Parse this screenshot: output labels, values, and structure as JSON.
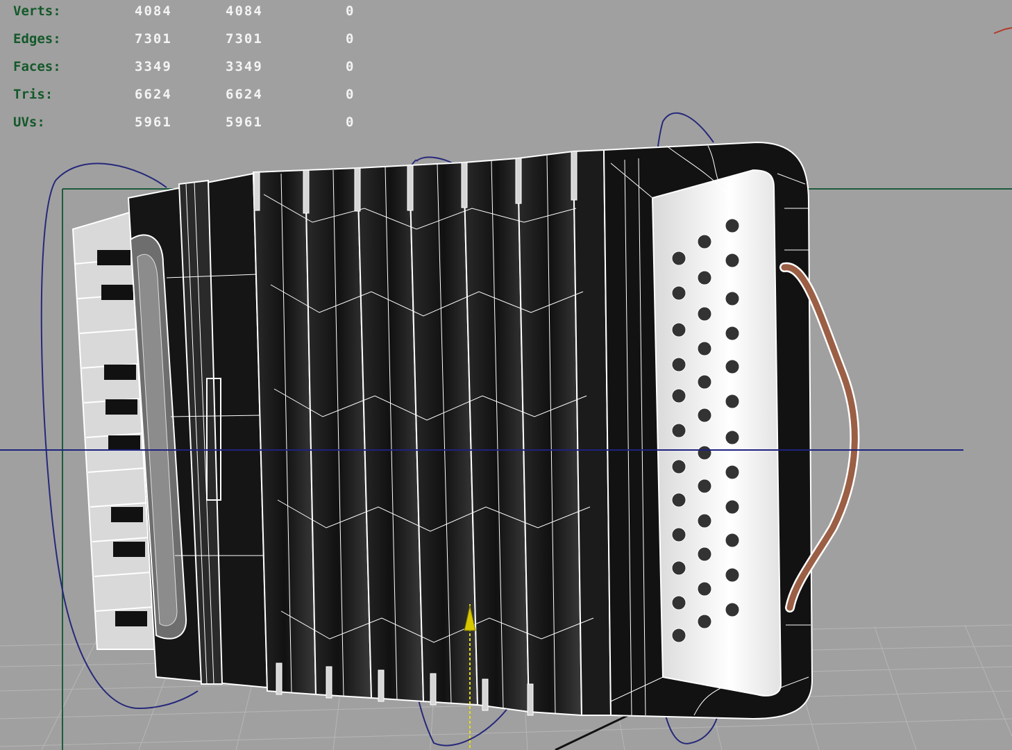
{
  "hud": {
    "rows": [
      {
        "label": "Verts:",
        "total": "4084",
        "selected": "4084",
        "extra": "0"
      },
      {
        "label": "Edges:",
        "total": "7301",
        "selected": "7301",
        "extra": "0"
      },
      {
        "label": "Faces:",
        "total": "3349",
        "selected": "3349",
        "extra": "0"
      },
      {
        "label": "Tris:",
        "total": "6624",
        "selected": "6624",
        "extra": "0"
      },
      {
        "label": "UVs:",
        "total": "5961",
        "selected": "5961",
        "extra": "0"
      }
    ]
  },
  "colors": {
    "background": "#a0a0a0",
    "hud_label": "#14592a",
    "hud_value": "#f4f4f4",
    "wireframe": "#ffffff",
    "body": "#141414",
    "strap": "#9a5f45",
    "curve": "#26287a",
    "camera_frame": "#1d5a3c"
  },
  "icons": [
    "move-pivot-icon"
  ]
}
